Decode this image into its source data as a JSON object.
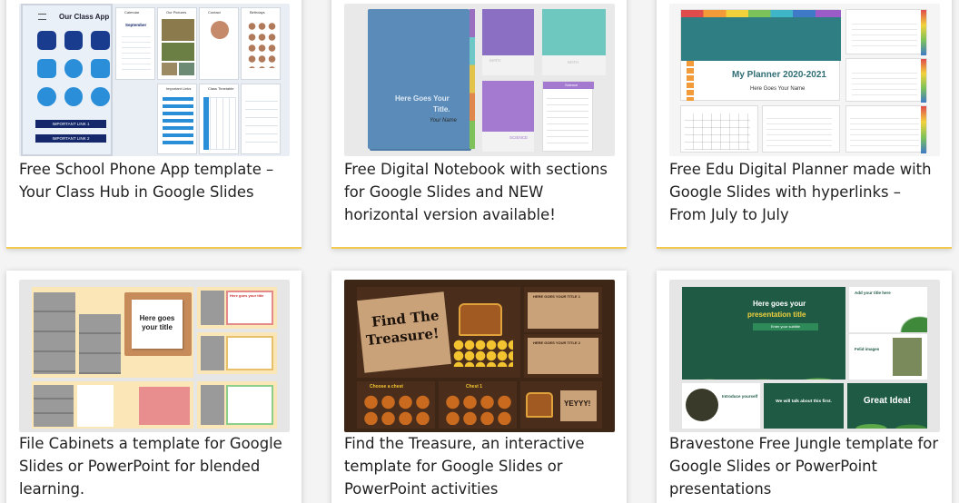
{
  "cards": [
    {
      "title": "Free School Phone App template – Your Class Hub in Google Slides",
      "thumb": {
        "app_title": "Our Class App",
        "panels": [
          "Calendar",
          "Our Pictures",
          "Contact",
          "Birthdays",
          "Important Links",
          "Class Timetable"
        ],
        "month": "September",
        "link1": "IMPORTANT LINK 1",
        "link2": "IMPORTANT LINK 2"
      }
    },
    {
      "title": "Free Digital Notebook with sections for Google Slides and NEW horizontal version available!",
      "thumb": {
        "cover_line1": "Here Goes Your",
        "cover_line2": "Title.",
        "signature": "Your Name",
        "tab1": "MATH",
        "tab2": "MATH",
        "tab3": "SCIENCE",
        "tab4": "Science"
      }
    },
    {
      "title": "Free Edu Digital Planner made with Google Slides with hyperlinks – From July to July",
      "thumb": {
        "planner_title": "My Planner 2020-2021",
        "planner_sub": "Here Goes Your Name"
      }
    },
    {
      "title": "File Cabinets a template for Google Slides or PowerPoint for blended learning.",
      "thumb": {
        "note_line1": "Here goes",
        "note_line2": "your title",
        "card_heading": "Here goes your title"
      }
    },
    {
      "title": "Find the Treasure, an interactive template for Google Slides or PowerPoint activities",
      "thumb": {
        "sign_line1": "Find The",
        "sign_line2": "Treasure!",
        "small1": "HERE GOES YOUR TITLE 1",
        "small2": "HERE GOES YOUR TITLE 2",
        "choose": "Choose a chest",
        "chest": "Chest 1",
        "yay": "YEYYY!"
      }
    },
    {
      "title": "Bravestone Free Jungle template for Google Slides or PowerPoint presentations",
      "thumb": {
        "hero_line1": "Here goes your",
        "hero_line2": "presentation title",
        "hero_sub": "Enter your subtitle",
        "side1": "Add your title here",
        "side2": "Felid images",
        "intro": "Introduce yourself",
        "talk": "We will talk about this first.",
        "idea": "Great Idea!"
      }
    }
  ],
  "colors": {
    "accent_border": "#f2c94c",
    "text": "#222222"
  }
}
